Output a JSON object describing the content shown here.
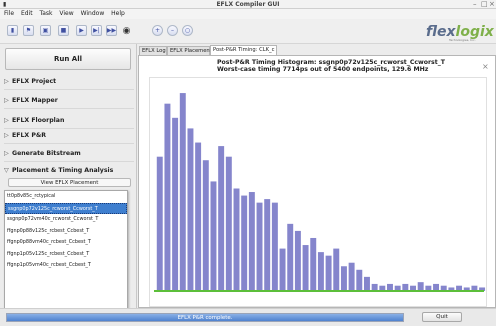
{
  "window": {
    "title": "EFLX Compiler GUI",
    "app_icon": "app-icon"
  },
  "menu": [
    "File",
    "Edit",
    "Task",
    "View",
    "Window",
    "Help"
  ],
  "toolbar": {
    "icons": [
      "open-folder-icon",
      "flag-icon",
      "save-icon",
      "tag-icon",
      "play-icon",
      "play-to-end-icon",
      "fast-forward-icon",
      "binoculars-icon"
    ],
    "zoom_icons": [
      "zoom-in-icon",
      "zoom-out-icon",
      "zoom-fit-icon"
    ]
  },
  "logo": {
    "text_main": "flex",
    "text_accent": "logix",
    "subtitle": "Technologies, Inc."
  },
  "left": {
    "run_all": "Run All",
    "sections": [
      "EFLX Project",
      "EFLX Mapper",
      "EFLX Floorplan",
      "EFLX P&R",
      "Generate Bitstream",
      "Placement & Timing Analysis"
    ],
    "view_placement": "View EFLX Placement",
    "corners": [
      "tt0p8v85c_rctypical",
      "ssgnp0p72v125c_rcworst_Ccworst_T",
      "ssgnp0p72vm40c_rcworst_Ccworst_T",
      "ffgnp0p88v125c_rcbest_Ccbest_T",
      "ffgnp0p88vm40c_rcbest_Ccbest_T",
      "ffgnp1p05v125c_rcbest_Ccbest_T",
      "ffgnp1p05vm40c_rcbest_Ccbest_T"
    ],
    "selected_corner_index": 1
  },
  "tabs": [
    "EFLX Log",
    "EFLX Placement",
    "Post-P&R Timing: CLK_c"
  ],
  "active_tab": 2,
  "chart_data": {
    "type": "bar",
    "title": "Post-P&R Timing Histogram: ssgnp0p72v125c_rcworst_Ccworst_T",
    "subtitle": "Worst-case timing 7714ps out of 5400 endpoints, 129.6 MHz",
    "values": [
      0,
      38,
      0,
      53,
      0,
      49,
      0,
      56,
      0,
      46,
      0,
      42,
      0,
      37,
      0,
      31,
      0,
      41,
      0,
      38,
      0,
      29,
      0,
      27,
      0,
      28,
      0,
      25,
      0,
      26,
      0,
      25,
      0,
      12,
      0,
      19,
      0,
      17,
      0,
      13,
      0,
      15,
      0,
      11,
      0,
      10,
      0,
      12,
      0,
      7,
      0,
      8,
      0,
      6,
      0,
      4,
      0,
      2,
      0,
      1.5,
      0,
      2,
      0,
      1.5,
      0,
      2,
      0,
      1.5,
      0,
      2.5,
      0,
      1.5,
      0,
      2,
      0,
      1.5,
      0,
      1,
      0,
      1.5,
      0,
      1,
      0,
      1.5,
      0,
      1
    ],
    "ylim": [
      0,
      58
    ],
    "bar_color": "#8585cc",
    "baseline_color": "#5cbf3a"
  },
  "status": {
    "message": "EFLX P&R complete.",
    "progress": 1.0,
    "quit": "Quit"
  }
}
